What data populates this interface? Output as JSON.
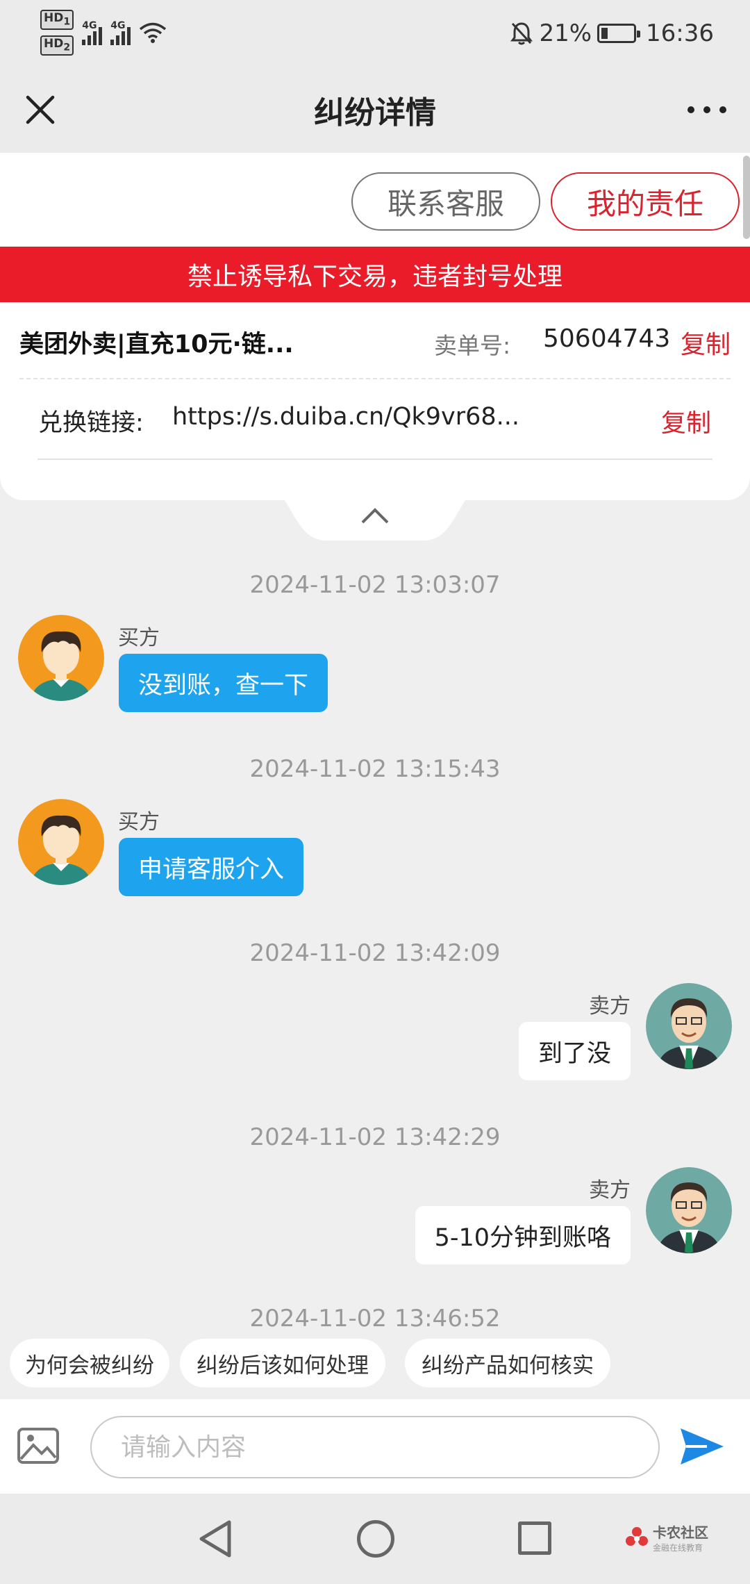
{
  "status_bar": {
    "hd1": "HD",
    "hd1_sub": "1",
    "hd2": "HD",
    "hd2_sub": "2",
    "net1": "4G",
    "net2": "4G",
    "battery_percent": "21%",
    "time": "16:36"
  },
  "header": {
    "title": "纠纷详情"
  },
  "actions": {
    "contact_service": "联系客服",
    "my_responsibility": "我的责任"
  },
  "warning_banner": "禁止诱导私下交易，违者封号处理",
  "order": {
    "product_name": "美团外卖|直充10元·链...",
    "order_label": "卖单号:",
    "order_number": "50604743",
    "copy_label": "复制"
  },
  "redeem": {
    "label": "兑换链接:",
    "value": "https://s.duiba.cn/Qk9vr68...",
    "copy_label": "复制"
  },
  "messages": [
    {
      "time": "2024-11-02 13:03:07",
      "role": "buyer",
      "sender": "买方",
      "text": "没到账，查一下"
    },
    {
      "time": "2024-11-02 13:15:43",
      "role": "buyer",
      "sender": "买方",
      "text": "申请客服介入"
    },
    {
      "time": "2024-11-02 13:42:09",
      "role": "seller",
      "sender": "卖方",
      "text": "到了没"
    },
    {
      "time": "2024-11-02 13:42:29",
      "role": "seller",
      "sender": "卖方",
      "text": "5-10分钟到账咯"
    }
  ],
  "partial_time": "2024-11-02 13:46:52",
  "quick_questions": [
    "为何会被纠纷",
    "纠纷后该如何处理",
    "纠纷产品如何核实"
  ],
  "composer": {
    "placeholder": "请输入内容"
  },
  "watermark": {
    "title": "卡农社区",
    "subtitle": "金融在线教育"
  },
  "colors": {
    "accent_red": "#eb1c2a",
    "buyer_bubble": "#1ea3ee",
    "send_blue": "#1e88e5"
  }
}
